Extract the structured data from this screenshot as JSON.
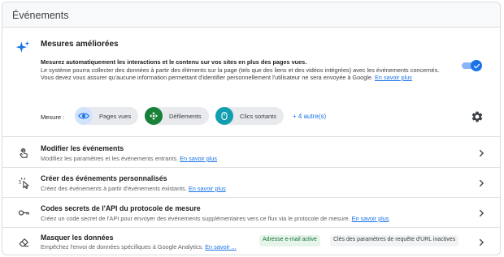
{
  "header": {
    "title": "Événements"
  },
  "enhanced": {
    "title": "Mesures améliorées",
    "desc_bold": "Mesurez automatiquement les interactions et le contenu sur vos sites en plus des pages vues.",
    "desc_text": "Le système pourra collecter des données à partir des éléments sur la page (tels que des liens et des vidéos intégrées) avec les événements concernés. Vous devez vous assurer qu'aucune information permettant d'identifier personnellement l'utilisateur ne sera envoyée à Google.",
    "desc_link": "En savoir plus",
    "toggle_on": true,
    "measure_label": "Mesure :",
    "chips": [
      {
        "label": "Pages vues",
        "icon": "eye-icon",
        "color": "#1a73e8",
        "bg": "#d2e3fc"
      },
      {
        "label": "Défilements",
        "icon": "scroll-icon",
        "color": "#ffffff",
        "bg": "#188038"
      },
      {
        "label": "Clics sortants",
        "icon": "mouse-icon",
        "color": "#ffffff",
        "bg": "#129eaf"
      }
    ],
    "more": "+ 4 autre(s)"
  },
  "rows": [
    {
      "title": "Modifier les événements",
      "sub": "Modifiez les paramètres et les événements entrants.",
      "link": "En savoir plus",
      "icon": "touch-icon"
    },
    {
      "title": "Créer des événements personnalisés",
      "sub": "Créez des événements à partir d'événements existants.",
      "link": "En savoir plus",
      "icon": "sparkle-click-icon"
    },
    {
      "title": "Codes secrets de l'API du protocole de mesure",
      "sub": "Créez un code secret de l'API pour envoyer des événements supplémentaires vers ce flux via le protocole de mesure.",
      "link": "En savoir plus",
      "icon": "key-icon"
    },
    {
      "title": "Masquer les données",
      "sub": "Empêchez l'envoi de données spécifiques à Google Analytics.",
      "link": "En savoir ...",
      "icon": "eraser-icon"
    }
  ],
  "badges": {
    "email": "Adresse e-mail active",
    "params": "Clés des paramètres de requête d'URL inactives"
  }
}
